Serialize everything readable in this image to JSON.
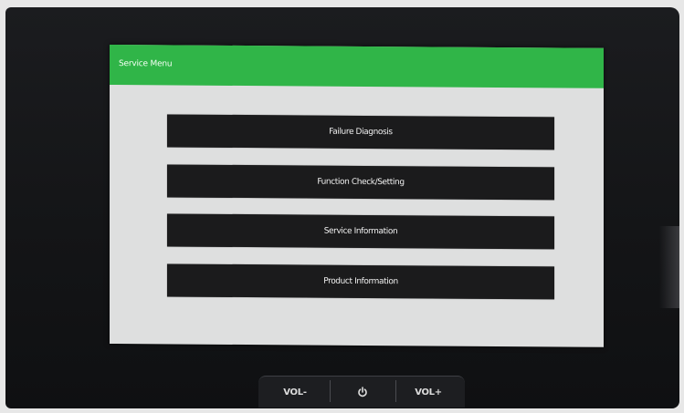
{
  "screen": {
    "title": "Service Menu",
    "menu_items": [
      {
        "label": "Failure Diagnosis"
      },
      {
        "label": "Function Check/Setting"
      },
      {
        "label": "Service Information"
      },
      {
        "label": "Product Information"
      }
    ]
  },
  "hardware": {
    "vol_down": "VOL-",
    "vol_up": "VOL+",
    "power_icon": "power-icon"
  },
  "colors": {
    "title_bar": "#30b548",
    "button": "#1b1b1c",
    "screen_bg": "#dedfdf",
    "bezel": "#151618"
  }
}
